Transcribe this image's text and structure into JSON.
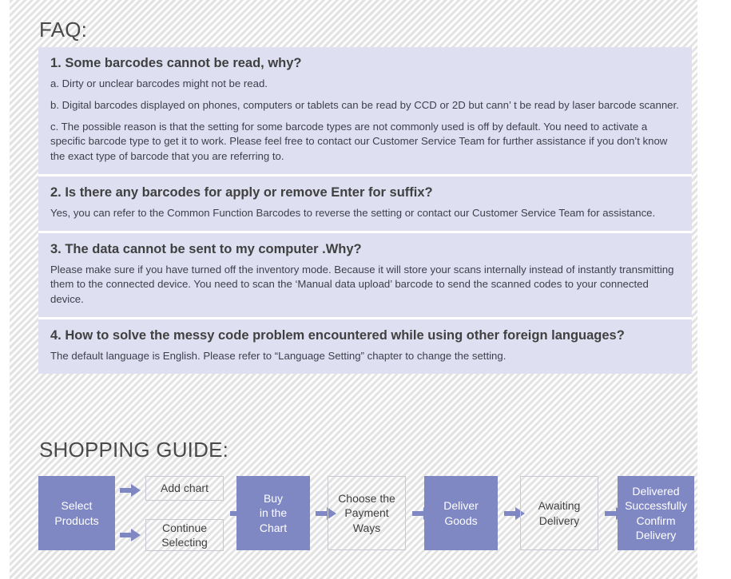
{
  "faq": {
    "title": "FAQ:",
    "panel_bg": "#dee0f2",
    "items": [
      {
        "question": "1. Some barcodes cannot be read, why?",
        "answers": [
          "a. Dirty or unclear barcodes might not be read.",
          "b. Digital barcodes displayed on phones, computers or tablets can be read by CCD or 2D but cann’ t be read by laser barcode scanner.",
          "c. The possible reason is that the setting for some barcode types are not commonly used is off by default. You need to activate a specific barcode type to get it to work. Please feel free to contact our Customer Service Team for further assistance if you don’t know the exact type of barcode that you are referring to."
        ]
      },
      {
        "question": "2. Is there any barcodes for apply or remove Enter for suffix?",
        "answers": [
          "Yes, you can refer to the Common Function Barcodes to reverse the setting or contact our Customer Service Team for assistance."
        ]
      },
      {
        "question": "3. The data cannot be sent to my computer .Why?",
        "answers": [
          "Please make sure if you have turned off the inventory mode. Because it will store your scans internally instead of instantly transmitting them to the connected device. You need to scan the  ‘Manual data upload’  barcode to send the scanned codes to your connected device."
        ]
      },
      {
        "question": "4. How to solve the messy code problem encountered while using other foreign languages?",
        "answers": [
          "The default language is English. Please refer to  “Language Setting”  chapter to change the setting."
        ]
      }
    ]
  },
  "shopping_guide": {
    "title": "SHOPPING GUIDE:",
    "accent_color": "#8088c4",
    "nodes": [
      {
        "id": "select-products",
        "style": "filled",
        "lines": [
          "Select",
          "Products"
        ]
      },
      {
        "id": "add-chart",
        "style": "outline",
        "lines": [
          "Add chart"
        ]
      },
      {
        "id": "continue-selecting",
        "style": "outline",
        "lines": [
          "Continue",
          "Selecting"
        ]
      },
      {
        "id": "buy-in-the-chart",
        "style": "filled",
        "lines": [
          "Buy",
          "in the",
          "Chart"
        ]
      },
      {
        "id": "choose-payment",
        "style": "outline",
        "lines": [
          "Choose the",
          "Payment",
          "Ways"
        ]
      },
      {
        "id": "deliver-goods",
        "style": "filled",
        "lines": [
          "Deliver",
          "Goods"
        ]
      },
      {
        "id": "awaiting-delivery",
        "style": "outline",
        "lines": [
          "Awaiting",
          "Delivery"
        ]
      },
      {
        "id": "delivered-confirm",
        "style": "filled",
        "lines": [
          "Delivered",
          "Successfully",
          "Confirm",
          "Delivery"
        ]
      }
    ],
    "arrow_icon": "right-block-arrow-icon"
  }
}
